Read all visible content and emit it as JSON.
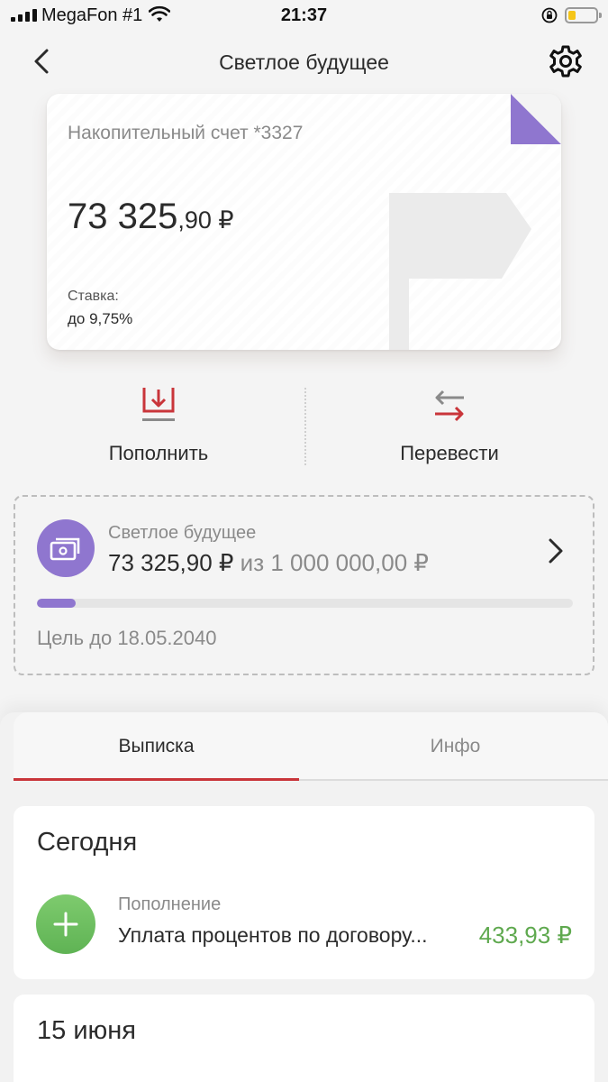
{
  "status_bar": {
    "carrier": "MegaFon #1",
    "time": "21:37"
  },
  "nav": {
    "title": "Светлое будущее"
  },
  "card": {
    "account_name": "Накопительный счет *3327",
    "balance_main": "73 325",
    "balance_fraction": ",90 ₽",
    "rate_label": "Ставка:",
    "rate_value": "до 9,75%",
    "accent_color": "#8f76cf"
  },
  "actions": {
    "top_up_label": "Пополнить",
    "transfer_label": "Перевести"
  },
  "goal": {
    "name": "Светлое будущее",
    "current": "73 325,90 ₽",
    "of_target": "из 1 000 000,00 ₽",
    "progress_fraction": 0.073,
    "deadline": "Цель до 18.05.2040"
  },
  "tabs": [
    {
      "label": "Выписка",
      "active": true
    },
    {
      "label": "Инфо",
      "active": false
    }
  ],
  "statement": {
    "groups": [
      {
        "date": "Сегодня",
        "transactions": [
          {
            "category": "Пополнение",
            "description": "Уплата процентов по договору...",
            "amount": "433,93 ₽"
          }
        ]
      },
      {
        "date": "15 июня",
        "transactions": []
      }
    ]
  },
  "colors": {
    "brand_red": "#c9353a",
    "goal_purple": "#8f76cf",
    "income_green": "#5fa94f"
  }
}
